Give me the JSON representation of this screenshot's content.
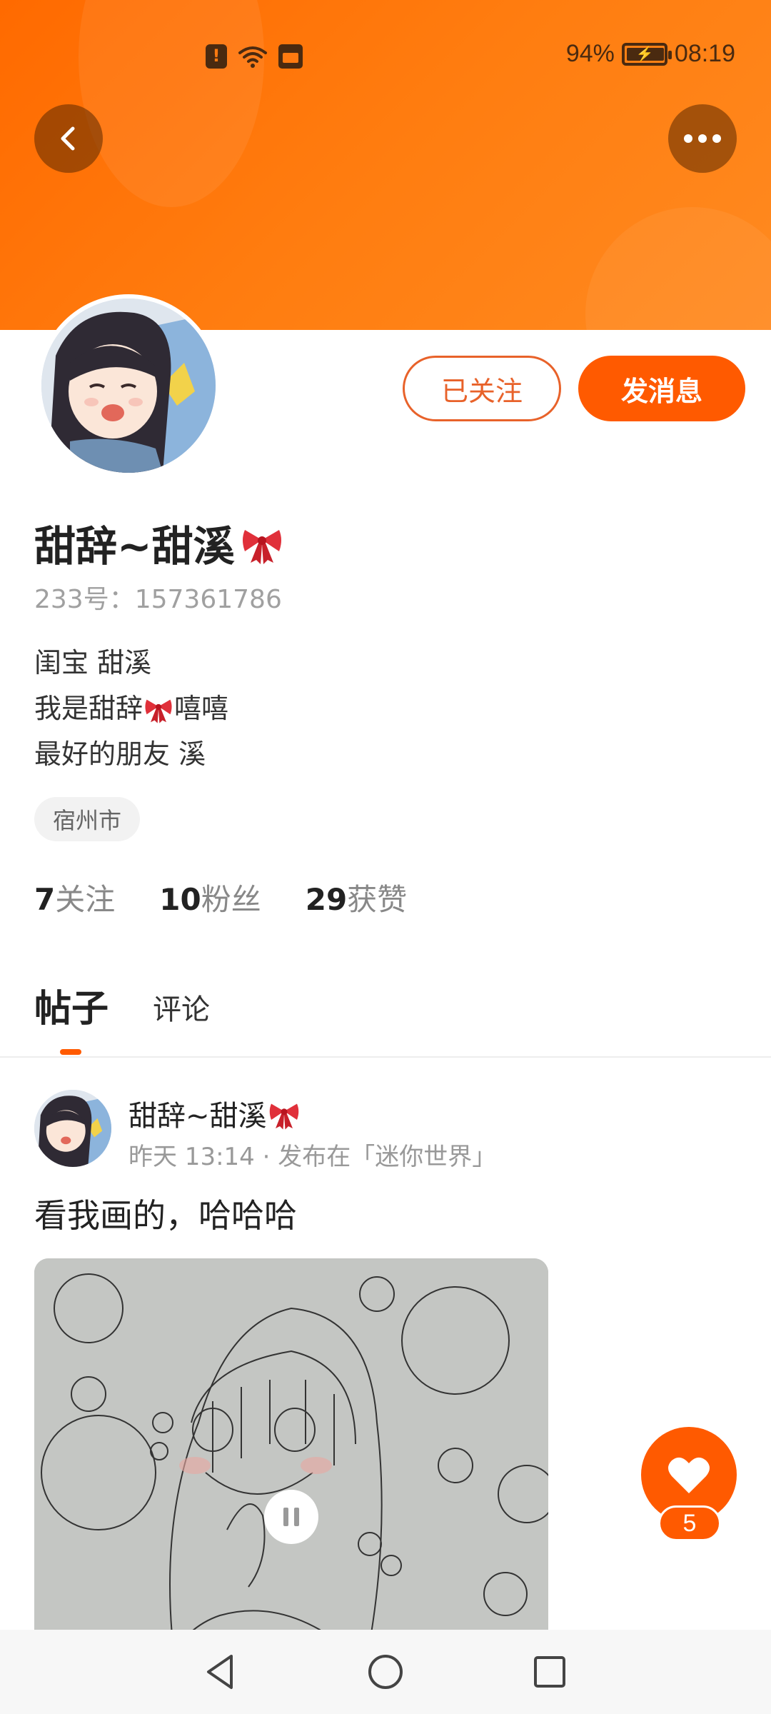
{
  "status_bar": {
    "battery": "94%",
    "time": "08:19"
  },
  "header": {
    "back_icon": "chevron-left-icon",
    "more_icon": "more-horizontal-icon"
  },
  "profile": {
    "followed_label": "已关注",
    "message_label": "发消息",
    "name": "甜辞~甜溪",
    "name_emoji": "ribbon-bow",
    "id_text": "233号：157361786",
    "bio_lines": [
      {
        "text": "闺宝   甜溪"
      },
      {
        "before": "我是甜辞",
        "emoji": "ribbon-bow",
        "after": "嘻嘻"
      },
      {
        "text": "最好的朋友   溪"
      }
    ],
    "location": "宿州市",
    "stats": [
      {
        "num": "7",
        "label": "关注"
      },
      {
        "num": "10",
        "label": "粉丝"
      },
      {
        "num": "29",
        "label": "获赞"
      }
    ]
  },
  "tabs": {
    "posts": "帖子",
    "comments": "评论"
  },
  "post": {
    "author": "甜辞~甜溪",
    "meta": "昨天 13:14 · 发布在「迷你世界」",
    "text": "看我画的，哈哈哈"
  },
  "like": {
    "count": "5",
    "icon": "heart-icon"
  },
  "colors": {
    "accent": "#ff5a00",
    "banner": "#ff7d10"
  }
}
